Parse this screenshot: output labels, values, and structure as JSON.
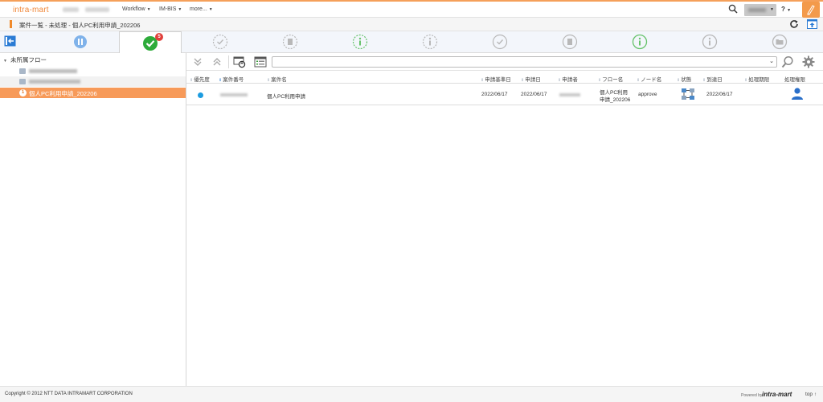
{
  "topbar": {
    "logo": "intra-mart",
    "nav": [
      {
        "label": "Workflow"
      },
      {
        "label": "IM-BIS"
      },
      {
        "label": "more..."
      }
    ],
    "help_label": "?"
  },
  "breadcrumb": {
    "text": "案件一覧 - 未処理 - 個人PC利用申請_202206"
  },
  "status_tabs": {
    "active_badge": "5",
    "colors": {
      "pause": "#6fa8e6",
      "active_check": "#2dab3a",
      "inactive": "#b8b8b8",
      "info_green": "#67c36b"
    }
  },
  "tree": {
    "root_label": "未所属フロー",
    "selected": {
      "number": "1",
      "label": "個人PC利用申請_202206"
    }
  },
  "table": {
    "headers": [
      "優先度",
      "案件番号",
      "案件名",
      "申請基準日",
      "申請日",
      "申請者",
      "フロー名",
      "ノード名",
      "状態",
      "到達日",
      "処理期限",
      "処理権限"
    ],
    "rows": [
      {
        "matter_name": "個人PC利用申請",
        "apply_base_date": "2022/06/17",
        "apply_date": "2022/06/17",
        "flow_name_line1": "個人PC利用",
        "flow_name_line2": "申請_202206",
        "node_name": "approve",
        "arrival_date": "2022/06/17"
      }
    ]
  },
  "footer": {
    "copyright": "Copyright © 2012 NTT DATA INTRAMART CORPORATION",
    "powered": "Powered by",
    "powered_logo": "intra-mart",
    "top_link": "top ↑"
  }
}
